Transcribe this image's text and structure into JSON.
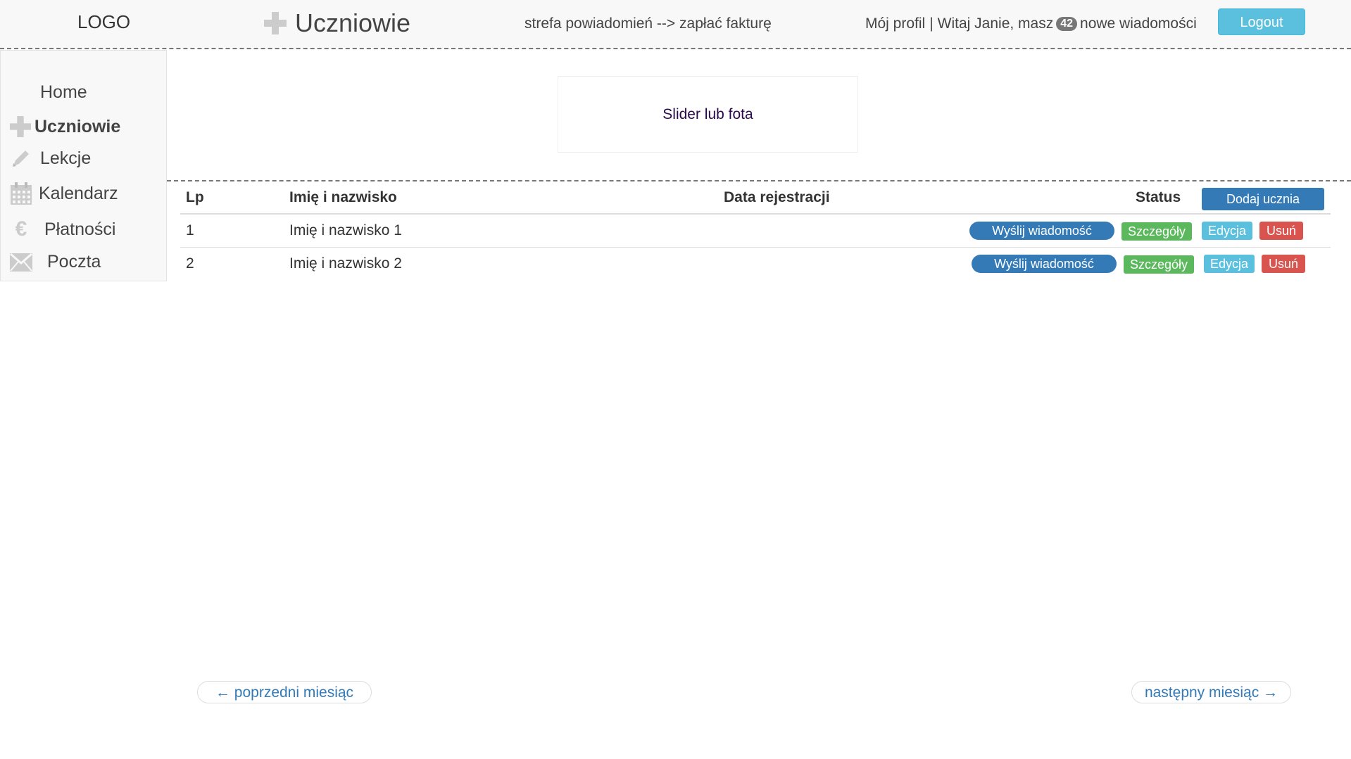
{
  "header": {
    "logo": "LOGO",
    "page_title": "Uczniowie",
    "notification_text": "strefa powiadomień --> zapłać fakturę",
    "profile_link": "Mój profil",
    "separator": "|",
    "welcome_prefix": "Witaj Janie, masz",
    "message_count": "42",
    "welcome_suffix": "nowe wiadomości",
    "logout_label": "Logout"
  },
  "sidebar": {
    "items": [
      {
        "label": "Home",
        "icon": "none",
        "active": false
      },
      {
        "label": "Uczniowie",
        "icon": "plus-icon",
        "active": true
      },
      {
        "label": "Lekcje",
        "icon": "pencil-icon",
        "active": false
      },
      {
        "label": "Kalendarz",
        "icon": "calendar-icon",
        "active": false
      },
      {
        "label": "Płatności",
        "icon": "euro-icon",
        "active": false
      },
      {
        "label": "Poczta",
        "icon": "envelope-icon",
        "active": false
      }
    ]
  },
  "slider": {
    "text": "Slider lub fota"
  },
  "table": {
    "headers": {
      "lp": "Lp",
      "name": "Imię i nazwisko",
      "date": "Data rejestracji",
      "status": "Status"
    },
    "add_button": "Dodaj ucznia",
    "rows": [
      {
        "lp": "1",
        "name": "Imię i nazwisko 1",
        "date": ""
      },
      {
        "lp": "2",
        "name": "Imię i nazwisko 2",
        "date": ""
      }
    ],
    "actions": {
      "message": "Wyślij wiadomość",
      "details": "Szczegóły",
      "edit": "Edycja",
      "delete": "Usuń"
    }
  },
  "pagination": {
    "prev": "← poprzedni miesiąc",
    "next": "następny miesiąc →"
  },
  "colors": {
    "primary": "#337ab7",
    "success": "#5cb85c",
    "info": "#5bc0de",
    "danger": "#d9534f",
    "header_bg": "#f8f8f8",
    "icon_gray": "#cccccc"
  }
}
